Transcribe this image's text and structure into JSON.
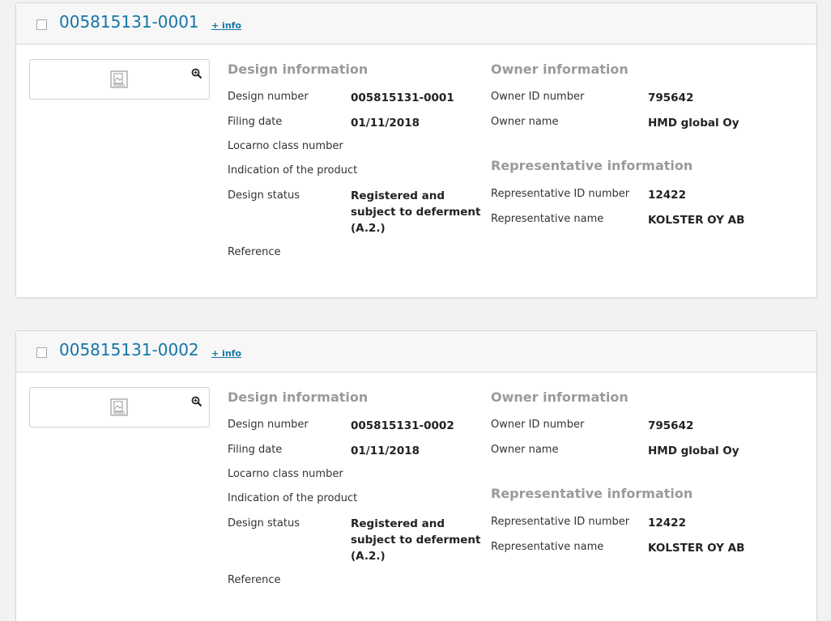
{
  "results": [
    {
      "design_id": "005815131-0001",
      "more_info": "+ info",
      "design_info": {
        "title": "Design information",
        "design_number_label": "Design number",
        "design_number": "005815131-0001",
        "filing_date_label": "Filing date",
        "filing_date": "01/11/2018",
        "locarno_label": "Locarno class number",
        "indication_label": "Indication of the product",
        "status_label": "Design status",
        "status_line1": "Registered and",
        "status_line2": "subject to deferment",
        "status_line3": "(A.2.)",
        "reference_label": "Reference"
      },
      "owner_info": {
        "title": "Owner information",
        "id_label": "Owner ID number",
        "id": "795642",
        "name_label": "Owner name",
        "name": "HMD global Oy"
      },
      "rep_info": {
        "title": "Representative information",
        "id_label": "Representative ID number",
        "id": "12422",
        "name_label": "Representative name",
        "name": "KOLSTER OY AB"
      }
    },
    {
      "design_id": "005815131-0002",
      "more_info": "+ info",
      "design_info": {
        "title": "Design information",
        "design_number_label": "Design number",
        "design_number": "005815131-0002",
        "filing_date_label": "Filing date",
        "filing_date": "01/11/2018",
        "locarno_label": "Locarno class number",
        "indication_label": "Indication of the product",
        "status_label": "Design status",
        "status_line1": "Registered and",
        "status_line2": "subject to deferment",
        "status_line3": "(A.2.)",
        "reference_label": "Reference"
      },
      "owner_info": {
        "title": "Owner information",
        "id_label": "Owner ID number",
        "id": "795642",
        "name_label": "Owner name",
        "name": "HMD global Oy"
      },
      "rep_info": {
        "title": "Representative information",
        "id_label": "Representative ID number",
        "id": "12422",
        "name_label": "Representative name",
        "name": "KOLSTER OY AB"
      }
    }
  ],
  "colors": {
    "link": "#1575a6",
    "section_title": "#9a9a9a",
    "header_bg": "#f7f7f7",
    "page_bg": "#f2f2f2"
  }
}
